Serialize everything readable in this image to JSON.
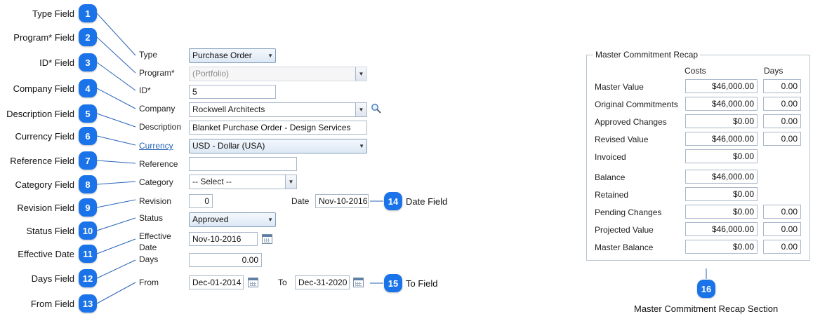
{
  "callouts": [
    {
      "num": "1",
      "text": "Type Field"
    },
    {
      "num": "2",
      "text": "Program* Field"
    },
    {
      "num": "3",
      "text": "ID* Field"
    },
    {
      "num": "4",
      "text": "Company Field"
    },
    {
      "num": "5",
      "text": "Description Field"
    },
    {
      "num": "6",
      "text": "Currency Field"
    },
    {
      "num": "7",
      "text": "Reference Field"
    },
    {
      "num": "8",
      "text": "Category Field"
    },
    {
      "num": "9",
      "text": "Revision Field"
    },
    {
      "num": "10",
      "text": "Status Field"
    },
    {
      "num": "11",
      "text": "Effective Date"
    },
    {
      "num": "12",
      "text": "Days Field"
    },
    {
      "num": "13",
      "text": "From Field"
    },
    {
      "num": "14",
      "text": "Date Field"
    },
    {
      "num": "15",
      "text": "To Field"
    },
    {
      "num": "16",
      "text": "Master Commitment Recap Section"
    }
  ],
  "form": {
    "type": {
      "label": "Type",
      "value": "Purchase Order"
    },
    "program": {
      "label": "Program*",
      "value": "(Portfolio)"
    },
    "id": {
      "label": "ID*",
      "value": "5"
    },
    "company": {
      "label": "Company",
      "value": "Rockwell Architects"
    },
    "description": {
      "label": "Description",
      "value": "Blanket Purchase Order  - Design Services"
    },
    "currency": {
      "label": "Currency",
      "value": "USD - Dollar (USA)"
    },
    "reference": {
      "label": "Reference",
      "value": ""
    },
    "category": {
      "label": "Category",
      "value": "-- Select --"
    },
    "revision": {
      "label": "Revision",
      "value": "0"
    },
    "date": {
      "label": "Date",
      "value": "Nov-10-2016"
    },
    "status": {
      "label": "Status",
      "value": "Approved"
    },
    "effective_date": {
      "label_line1": "Effective",
      "label_line2": "Date",
      "value": "Nov-10-2016"
    },
    "days": {
      "label": "Days",
      "value": "0.00"
    },
    "from": {
      "label": "From",
      "value": "Dec-01-2014"
    },
    "to": {
      "label": "To",
      "value": "Dec-31-2020"
    }
  },
  "recap": {
    "title": "Master Commitment Recap",
    "col_costs": "Costs",
    "col_days": "Days",
    "rows": [
      {
        "label": "Master Value",
        "cost": "$46,000.00",
        "days": "0.00"
      },
      {
        "label": "Original Commitments",
        "cost": "$46,000.00",
        "days": "0.00"
      },
      {
        "label": "Approved Changes",
        "cost": "$0.00",
        "days": "0.00"
      },
      {
        "label": "Revised Value",
        "cost": "$46,000.00",
        "days": "0.00"
      },
      {
        "label": "Invoiced",
        "cost": "$0.00"
      },
      {
        "label": "Balance",
        "cost": "$46,000.00"
      },
      {
        "label": "Retained",
        "cost": "$0.00"
      },
      {
        "label": "Pending Changes",
        "cost": "$0.00",
        "days": "0.00"
      },
      {
        "label": "Projected Value",
        "cost": "$46,000.00",
        "days": "0.00"
      },
      {
        "label": "Master Balance",
        "cost": "$0.00",
        "days": "0.00"
      }
    ]
  },
  "colors": {
    "badge": "#1a73e8",
    "link": "#1f5fb5",
    "connector": "#2a63b8"
  }
}
